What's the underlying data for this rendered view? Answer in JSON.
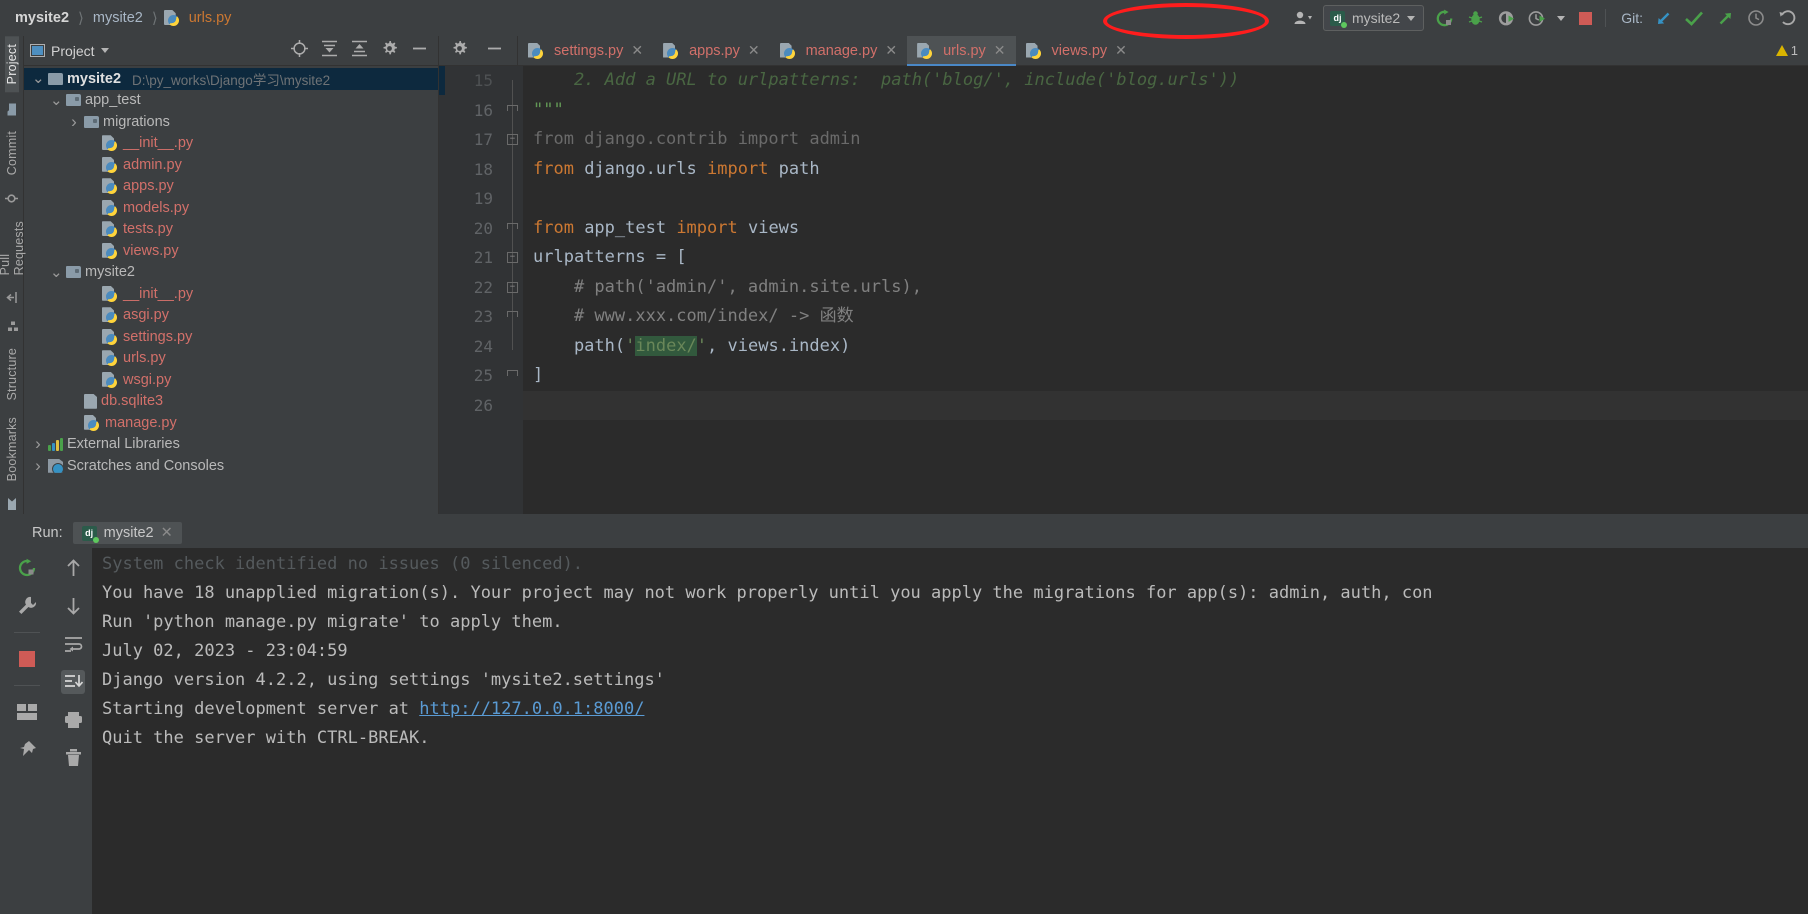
{
  "breadcrumb": {
    "items": [
      "mysite2",
      "mysite2",
      "urls.py"
    ]
  },
  "toolbar": {
    "avatar_icon": "user-icon",
    "run_config_name": "mysite2",
    "run_icon": "rerun-icon",
    "debug_icon": "bug-icon",
    "coverage_icon": "run-with-coverage-icon",
    "profile_icon": "profiler-icon",
    "stop_icon": "stop-icon",
    "git_label": "Git:",
    "git_update_icon": "update-project-icon",
    "git_commit_icon": "commit-icon",
    "git_push_icon": "push-icon",
    "git_history_icon": "history-icon",
    "git_rollback_icon": "rollback-icon"
  },
  "left_strip": {
    "tabs": [
      {
        "label": "Project",
        "icon": "project-folder-icon",
        "active": true
      },
      {
        "label": "Commit",
        "icon": "commit-icon",
        "active": false
      },
      {
        "label": "Pull Requests",
        "icon": "pull-request-icon",
        "active": false
      }
    ]
  },
  "bottom_strip": {
    "tabs": [
      {
        "label": "Structure",
        "icon": "structure-icon"
      },
      {
        "label": "Bookmarks",
        "icon": "bookmark-icon"
      }
    ]
  },
  "project_pane": {
    "title": "Project",
    "header_icons": [
      "locate-icon",
      "expand-all-icon",
      "collapse-all-icon",
      "gear-icon",
      "minimize-icon"
    ],
    "tree": [
      {
        "indent": 0,
        "arrow": "v",
        "icon": "folder",
        "name": "mysite2",
        "path": "D:\\py_works\\Django学习\\mysite2",
        "selected": true,
        "bold": true,
        "kind": "dir"
      },
      {
        "indent": 1,
        "arrow": "v",
        "icon": "module",
        "name": "app_test",
        "path": "",
        "selected": false,
        "bold": false,
        "kind": "dir"
      },
      {
        "indent": 2,
        "arrow": ">",
        "icon": "module",
        "name": "migrations",
        "path": "",
        "selected": false,
        "bold": false,
        "kind": "dir"
      },
      {
        "indent": 3,
        "arrow": "",
        "icon": "python",
        "name": "__init__.py",
        "path": "",
        "selected": false,
        "bold": false,
        "kind": "py"
      },
      {
        "indent": 3,
        "arrow": "",
        "icon": "python",
        "name": "admin.py",
        "path": "",
        "selected": false,
        "bold": false,
        "kind": "py"
      },
      {
        "indent": 3,
        "arrow": "",
        "icon": "python",
        "name": "apps.py",
        "path": "",
        "selected": false,
        "bold": false,
        "kind": "py"
      },
      {
        "indent": 3,
        "arrow": "",
        "icon": "python",
        "name": "models.py",
        "path": "",
        "selected": false,
        "bold": false,
        "kind": "py"
      },
      {
        "indent": 3,
        "arrow": "",
        "icon": "python",
        "name": "tests.py",
        "path": "",
        "selected": false,
        "bold": false,
        "kind": "py"
      },
      {
        "indent": 3,
        "arrow": "",
        "icon": "python",
        "name": "views.py",
        "path": "",
        "selected": false,
        "bold": false,
        "kind": "py"
      },
      {
        "indent": 1,
        "arrow": "v",
        "icon": "module",
        "name": "mysite2",
        "path": "",
        "selected": false,
        "bold": false,
        "kind": "dir"
      },
      {
        "indent": 3,
        "arrow": "",
        "icon": "python",
        "name": "__init__.py",
        "path": "",
        "selected": false,
        "bold": false,
        "kind": "py"
      },
      {
        "indent": 3,
        "arrow": "",
        "icon": "python",
        "name": "asgi.py",
        "path": "",
        "selected": false,
        "bold": false,
        "kind": "py"
      },
      {
        "indent": 3,
        "arrow": "",
        "icon": "python",
        "name": "settings.py",
        "path": "",
        "selected": false,
        "bold": false,
        "kind": "py"
      },
      {
        "indent": 3,
        "arrow": "",
        "icon": "python",
        "name": "urls.py",
        "path": "",
        "selected": false,
        "bold": false,
        "kind": "py"
      },
      {
        "indent": 3,
        "arrow": "",
        "icon": "python",
        "name": "wsgi.py",
        "path": "",
        "selected": false,
        "bold": false,
        "kind": "py"
      },
      {
        "indent": 2,
        "arrow": "",
        "icon": "file",
        "name": "db.sqlite3",
        "path": "",
        "selected": false,
        "bold": false,
        "kind": "py"
      },
      {
        "indent": 2,
        "arrow": "",
        "icon": "python",
        "name": "manage.py",
        "path": "",
        "selected": false,
        "bold": false,
        "kind": "py"
      },
      {
        "indent": 0,
        "arrow": ">",
        "icon": "library",
        "name": "External Libraries",
        "path": "",
        "selected": false,
        "bold": false,
        "kind": "dir"
      },
      {
        "indent": 0,
        "arrow": ">",
        "icon": "scratch",
        "name": "Scratches and Consoles",
        "path": "",
        "selected": false,
        "bold": false,
        "kind": "dir"
      }
    ]
  },
  "editor": {
    "tabs": [
      {
        "label": "settings.py",
        "active": false
      },
      {
        "label": "apps.py",
        "active": false
      },
      {
        "label": "manage.py",
        "active": false
      },
      {
        "label": "urls.py",
        "active": true
      },
      {
        "label": "views.py",
        "active": false
      }
    ],
    "warning_count": "1",
    "lines": [
      {
        "no": "15",
        "segments": [
          {
            "t": "    2. Add a URL to urlpatterns:  path('blog/', include('blog.urls'))",
            "c": "doc"
          }
        ],
        "partial": true,
        "fold": ""
      },
      {
        "no": "16",
        "segments": [
          {
            "t": "\"\"\"",
            "c": "doc"
          }
        ],
        "fold": "end"
      },
      {
        "no": "17",
        "segments": [
          {
            "t": "from django.contrib import admin",
            "c": "dim"
          }
        ],
        "fold": "start"
      },
      {
        "no": "18",
        "segments": [
          {
            "t": "from",
            "c": "k"
          },
          {
            "t": " django.urls ",
            "c": ""
          },
          {
            "t": "import",
            "c": "k"
          },
          {
            "t": " path",
            "c": ""
          }
        ],
        "fold": ""
      },
      {
        "no": "19",
        "segments": [],
        "fold": ""
      },
      {
        "no": "20",
        "segments": [
          {
            "t": "from",
            "c": "k"
          },
          {
            "t": " app_test ",
            "c": ""
          },
          {
            "t": "import",
            "c": "k"
          },
          {
            "t": " views",
            "c": ""
          }
        ],
        "fold": "end"
      },
      {
        "no": "21",
        "segments": [
          {
            "t": "urlpatterns = [",
            "c": ""
          }
        ],
        "fold": "start"
      },
      {
        "no": "22",
        "segments": [
          {
            "t": "    # path('admin/', admin.site.urls),",
            "c": "cm"
          }
        ],
        "fold": "start"
      },
      {
        "no": "23",
        "segments": [
          {
            "t": "    # www.xxx.com/index/ -> 函数",
            "c": "cm"
          }
        ],
        "fold": "end"
      },
      {
        "no": "24",
        "segments": [
          {
            "t": "    path(",
            "c": ""
          },
          {
            "t": "'",
            "c": "s"
          },
          {
            "t": "index/",
            "c": "s hlmatch"
          },
          {
            "t": "'",
            "c": "s"
          },
          {
            "t": ", views.index)",
            "c": ""
          }
        ],
        "fold": ""
      },
      {
        "no": "25",
        "segments": [
          {
            "t": "]",
            "c": ""
          }
        ],
        "fold": "end"
      },
      {
        "no": "26",
        "segments": [],
        "fold": ""
      }
    ]
  },
  "run_panel": {
    "label": "Run:",
    "tab_name": "mysite2",
    "tools_left": [
      "rerun-icon",
      "wrench-icon",
      "stop-icon",
      "layout-icon",
      "pin-icon"
    ],
    "tools_right": [
      "scroll-up-icon",
      "scroll-down-icon",
      "soft-wrap-icon",
      "scroll-to-end-icon",
      "print-icon",
      "trash-icon"
    ],
    "console_lines": [
      {
        "text": "System check identified no issues (0 silenced).",
        "partial": true
      },
      {
        "text": "",
        "partial": false
      },
      {
        "text": "You have 18 unapplied migration(s). Your project may not work properly until you apply the migrations for app(s): admin, auth, con",
        "partial": false
      },
      {
        "text": "Run 'python manage.py migrate' to apply them.",
        "partial": false
      },
      {
        "text": "July 02, 2023 - 23:04:59",
        "partial": false
      },
      {
        "text": "Django version 4.2.2, using settings 'mysite2.settings'",
        "partial": false
      },
      {
        "text": "Starting development server at ",
        "link": "http://127.0.0.1:8000/",
        "partial": false
      },
      {
        "text": "Quit the server with CTRL-BREAK.",
        "partial": false
      }
    ]
  },
  "colors": {
    "accent_blue": "#4a88c7",
    "python_file": "#d2706a",
    "keyword_orange": "#cc7832",
    "string_green": "#6a8759",
    "annotation_red": "#ff1d1d",
    "selection_blue": "#0d293e"
  }
}
